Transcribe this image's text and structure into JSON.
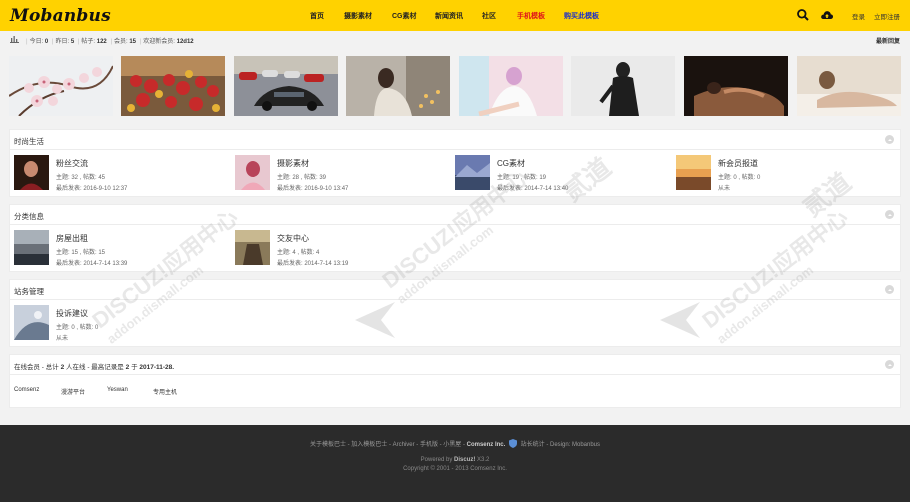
{
  "header": {
    "logo": "Mobanbus",
    "nav": [
      "首页",
      "摄影素材",
      "CG素材",
      "新闻资讯",
      "社区",
      "手机模板",
      "购买此模板"
    ],
    "login": "登录",
    "register": "立即注册"
  },
  "stats": {
    "today_label": "今日:",
    "today": "0",
    "yesterday_label": "昨日:",
    "yesterday": "5",
    "posts_label": "帖子:",
    "posts": "122",
    "members_label": "会员:",
    "members": "15",
    "newest_label": "欢迎新会员:",
    "newest": "12d12",
    "latest_reply": "最新回复"
  },
  "sections": [
    {
      "title": "时尚生活",
      "forums": [
        {
          "name": "粉丝交流",
          "topics": "主题: 32 , 帖数: 45",
          "last": "最后发表: 2016-9-10 12:37"
        },
        {
          "name": "摄影素材",
          "topics": "主题: 28 , 帖数: 39",
          "last": "最后发表: 2016-9-10 13:47"
        },
        {
          "name": "CG素材",
          "topics": "主题: 19 , 帖数: 19",
          "last": "最后发表: 2014-7-14 13:40"
        },
        {
          "name": "新会员报道",
          "topics": "主题: 0 , 帖数: 0",
          "last": "从未"
        }
      ]
    },
    {
      "title": "分类信息",
      "forums": [
        {
          "name": "房屋出租",
          "topics": "主题: 15 , 帖数: 15",
          "last": "最后发表: 2014-7-14 13:39"
        },
        {
          "name": "交友中心",
          "topics": "主题: 4 , 帖数: 4",
          "last": "最后发表: 2014-7-14 13:19"
        }
      ]
    },
    {
      "title": "站务管理",
      "forums": [
        {
          "name": "投诉建议",
          "topics": "主题: 0 , 帖数: 0",
          "last": "从未"
        }
      ]
    }
  ],
  "online": {
    "prefix": "在线会员 - 总计",
    "total": "2",
    "middle": "人在线 - 最高记录是",
    "record": "2",
    "on": "于",
    "date": "2017-11-28.",
    "links": [
      "Comsenz",
      "漫游平台",
      "Yeswan",
      "专用主机"
    ]
  },
  "watermark": {
    "text": "DISCUZ!应用中心",
    "domain": "addon.dismall.com",
    "mark": "贰道"
  },
  "footer": {
    "links": "关于模板巴士 - 加入模板巴士 - Archiver - 手机版 - 小黑屋 -",
    "company": "Comsenz Inc.",
    "links2": "站长统计 - Design: Mobanbus",
    "powered_prefix": "Powered by",
    "powered_name": "Discuz!",
    "powered_ver": "X3.2",
    "copyright": "Copyright © 2001 - 2013 Comsenz Inc."
  },
  "colors": {
    "header_bg": "#ffd200",
    "mobile_link": "#e0151a",
    "buy_link": "#1d2fc8",
    "footer_bg": "#2b2b2b"
  }
}
